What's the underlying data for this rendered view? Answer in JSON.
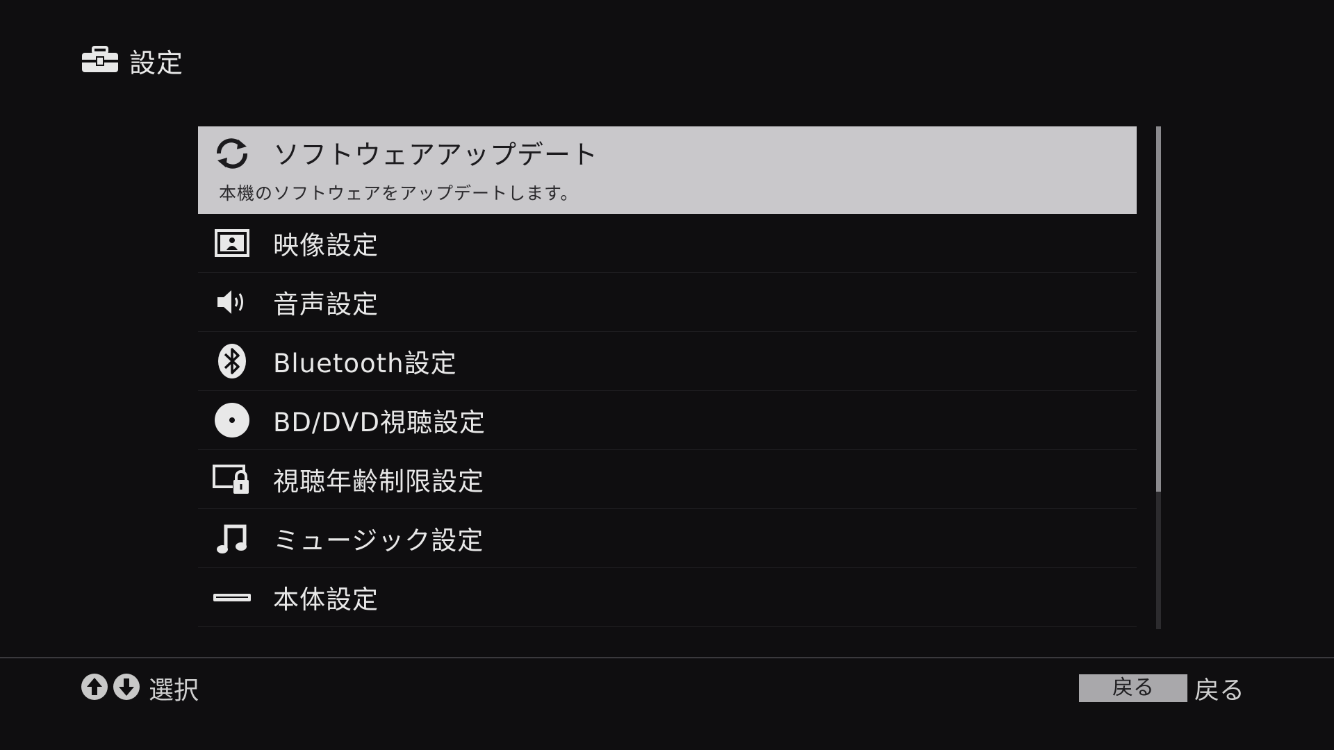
{
  "header": {
    "icon": "toolbox-icon",
    "title": "設定"
  },
  "menu": {
    "items": [
      {
        "icon": "refresh-icon",
        "label": "ソフトウェアアップデート",
        "description": "本機のソフトウェアをアップデートします。",
        "selected": true
      },
      {
        "icon": "picture-icon",
        "label": "映像設定"
      },
      {
        "icon": "speaker-icon",
        "label": "音声設定"
      },
      {
        "icon": "bluetooth-icon",
        "label": "Bluetooth設定"
      },
      {
        "icon": "disc-icon",
        "label": "BD/DVD視聴設定"
      },
      {
        "icon": "parental-lock-icon",
        "label": "視聴年齢制限設定"
      },
      {
        "icon": "music-note-icon",
        "label": "ミュージック設定"
      },
      {
        "icon": "device-icon",
        "label": "本体設定"
      }
    ]
  },
  "footer": {
    "select_label": "選択",
    "back_button_label": "戻る",
    "back_label": "戻る"
  },
  "colors": {
    "background": "#0f0e10",
    "selected_background": "#c9c8cb",
    "text": "#e8e8e8"
  }
}
